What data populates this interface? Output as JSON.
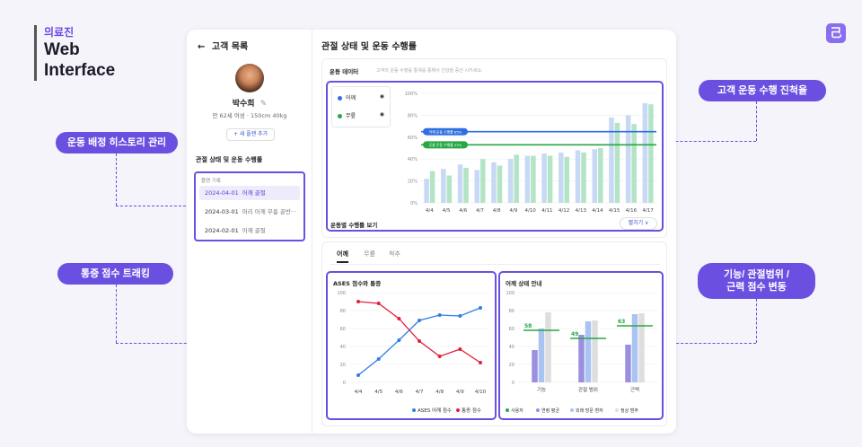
{
  "brand": {
    "korean": "의료진",
    "line1": "Web",
    "line2": "Interface",
    "logo_glyph": "己"
  },
  "callouts": {
    "history": "운동 배정 히스토리 관리",
    "pain": "통증 점수 트래킹",
    "progress": "고객 운동 수행 진척율",
    "function_line1": "기능/ 관절범위 /",
    "function_line2": "근력 점수 변동"
  },
  "sidebar": {
    "back_label": "고객 목록",
    "patient_name": "박수희",
    "patient_info": "만 62세  여성  ·  150cm  40kg",
    "new_plan_label": "+ 새 플랜 추가",
    "section_title": "관절 상태 및 운동 수행률",
    "plan_history_title": "플랜 기록",
    "plans": [
      {
        "date": "2024-04-01",
        "title": "어깨 골절",
        "selected": true
      },
      {
        "date": "2024-03-01",
        "title": "머리 어깨 무릎 골반···",
        "selected": false
      },
      {
        "date": "2024-02-01",
        "title": "어깨 골절",
        "selected": false
      }
    ]
  },
  "main": {
    "title": "관절 상태 및 운동 수행률",
    "exercise_data_title": "운동 데이터",
    "exercise_data_subtitle": "고객의 운동 수행률 통계를 통해서 건강을 증진 시키세요.",
    "legend": [
      {
        "label": "어깨",
        "color": "#2f6fe0"
      },
      {
        "label": "무릎",
        "color": "#28a745"
      }
    ],
    "by_exercise_label": "운동별 수행률 보기",
    "collapse_label": "펼치기 ∨",
    "tabs": [
      {
        "label": "어깨",
        "active": true
      },
      {
        "label": "무릎",
        "active": false
      },
      {
        "label": "척추",
        "active": false
      }
    ],
    "ases_title": "ASES 점수와 통증",
    "shoulder_title": "어깨 상태 안내"
  },
  "chart_data": [
    {
      "type": "bar",
      "categories": [
        "4/4",
        "4/5",
        "4/6",
        "4/7",
        "4/8",
        "4/9",
        "4/10",
        "4/11",
        "4/12",
        "4/13",
        "4/14",
        "4/15",
        "4/16",
        "4/17"
      ],
      "ylim": [
        0,
        100
      ],
      "yticks": [
        "0%",
        "20%",
        "40%",
        "60%",
        "80%",
        "100%"
      ],
      "series": [
        {
          "name": "어깨",
          "color": "#c7d9f5",
          "values": [
            22,
            31,
            35,
            30,
            37,
            40,
            43,
            45,
            46,
            48,
            49,
            78,
            80,
            91
          ]
        },
        {
          "name": "무릎",
          "color": "#b2e4c5",
          "values": [
            29,
            25,
            32,
            40,
            34,
            44,
            43,
            43,
            42,
            46,
            50,
            73,
            72,
            90
          ]
        }
      ],
      "reference_lines": [
        {
          "label": "어깨 운동 수행률 65%",
          "value": 65,
          "color": "#2f6fe0"
        },
        {
          "label": "무릎 운동 수행률 53%",
          "value": 53,
          "color": "#28a745"
        }
      ]
    },
    {
      "type": "line",
      "title": "ASES 점수와 통증",
      "categories": [
        "4/4",
        "4/5",
        "4/6",
        "4/7",
        "4/8",
        "4/9",
        "4/10"
      ],
      "ylim": [
        0,
        100
      ],
      "yticks": [
        "0",
        "20",
        "40",
        "60",
        "80",
        "100"
      ],
      "series": [
        {
          "name": "ASES 어깨 점수",
          "color": "#2f7fe0",
          "values": [
            8,
            26,
            47,
            69,
            75,
            74,
            83
          ]
        },
        {
          "name": "통증 점수",
          "color": "#e0203a",
          "values": [
            90,
            88,
            71,
            46,
            29,
            37,
            22
          ]
        }
      ]
    },
    {
      "type": "bar",
      "title": "어깨 상태 안내",
      "categories": [
        "기능",
        "관절 범위",
        "근력"
      ],
      "ylim": [
        0,
        100
      ],
      "yticks": [
        "0",
        "20",
        "40",
        "60",
        "80",
        "100"
      ],
      "series": [
        {
          "name": "사용자",
          "color": "#28a745",
          "values": [
            58,
            49,
            63
          ]
        },
        {
          "name": "연령 평균",
          "color": "#9b8fe0",
          "values": [
            36,
            53,
            42
          ]
        },
        {
          "name": "외래 방문 환자",
          "color": "#a9c4f2",
          "values": [
            60,
            68,
            76
          ]
        },
        {
          "name": "정상 범주",
          "color": "#dedede",
          "values": [
            78,
            69,
            77
          ]
        }
      ]
    }
  ]
}
